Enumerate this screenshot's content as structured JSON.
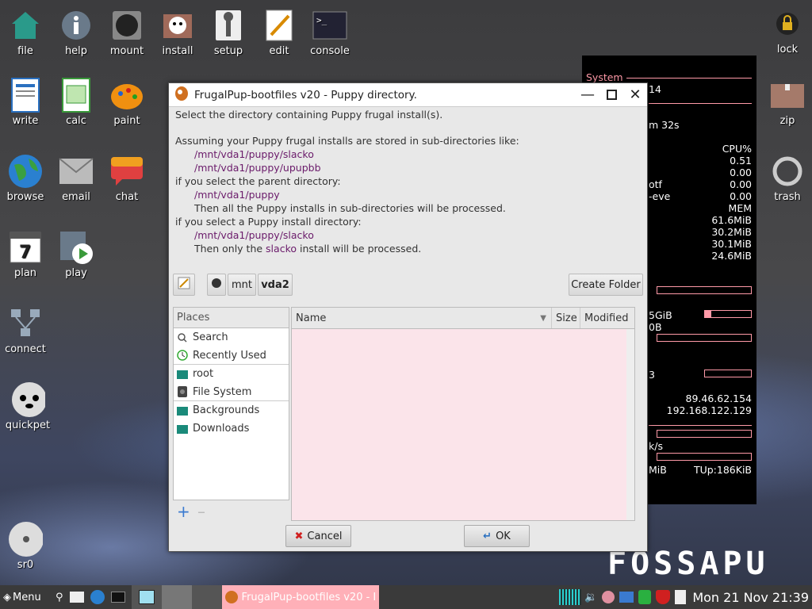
{
  "desktop_icons": {
    "file": "file",
    "help": "help",
    "mount": "mount",
    "install": "install",
    "setup": "setup",
    "edit": "edit",
    "console": "console",
    "lock": "lock",
    "write": "write",
    "calc": "calc",
    "paint": "paint",
    "zip": "zip",
    "browse": "browse",
    "email": "email",
    "chat": "chat",
    "trash": "trash",
    "plan": "plan",
    "play": "play",
    "connect": "connect",
    "quickpet": "quickpet",
    "sr0": "sr0"
  },
  "plan_day": "7",
  "brand": "FOSSAPU",
  "sysmon": {
    "title": "System",
    "uptime_num": "14",
    "uptime": "m 32s",
    "cpu_header": "CPU%",
    "procs": [
      {
        "name": "",
        "cpu": "0.51"
      },
      {
        "name": "",
        "cpu": "0.00"
      },
      {
        "name": "otf",
        "cpu": "0.00"
      },
      {
        "name": "-eve",
        "cpu": "0.00"
      }
    ],
    "mem_header": "MEM",
    "mems": [
      "61.6MiB",
      "30.2MiB",
      "30.1MiB",
      "24.6MiB"
    ],
    "disk_label": "5GiB",
    "disk_label2": "0B",
    "net_frag": "3",
    "ip_public": "89.46.62.154",
    "ip_local": "192.168.122.129",
    "speed": "k/s",
    "down": "MiB",
    "up": "TUp:186KiB"
  },
  "dialog": {
    "title": "FrugalPup-bootfiles v20 - Puppy directory.",
    "instruction": "Select the directory containing Puppy frugal install(s).",
    "assume": "Assuming your Puppy frugal installs are stored in sub-directories like:",
    "path1": "/mnt/vda1/puppy/slacko",
    "path2": "/mnt/vda1/puppy/upupbb",
    "parent": "if you select the parent directory:",
    "path3": "/mnt/vda1/puppy",
    "all_processed": "Then all the Puppy installs in sub-directories will be processed.",
    "install_dir": "if you select a Puppy install directory:",
    "path4": "/mnt/vda1/puppy/slacko",
    "only_pre": "Then only the ",
    "only_name": "slacko",
    "only_post": " install will be processed.",
    "crumbs": [
      "mnt",
      "vda2"
    ],
    "create_folder": "Create Folder",
    "places_header": "Places",
    "places": [
      {
        "label": "Search",
        "icon": "search-icon"
      },
      {
        "label": "Recently Used",
        "icon": "recent-icon"
      },
      {
        "label": "root",
        "icon": "home-folder-icon"
      },
      {
        "label": "File System",
        "icon": "drive-icon"
      },
      {
        "label": "Backgrounds",
        "icon": "folder-icon"
      },
      {
        "label": "Downloads",
        "icon": "folder-icon"
      }
    ],
    "columns": {
      "name": "Name",
      "size": "Size",
      "modified": "Modified"
    },
    "cancel": "Cancel",
    "ok": "OK"
  },
  "taskbar": {
    "menu": "Menu",
    "task_label": "FrugalPup-bootfiles v20 - I",
    "clock": "Mon 21 Nov 21:39"
  },
  "colors": {
    "path": "#6a1a6a",
    "file_bg": "#fbe4ea",
    "accent": "#ff9aa8"
  }
}
